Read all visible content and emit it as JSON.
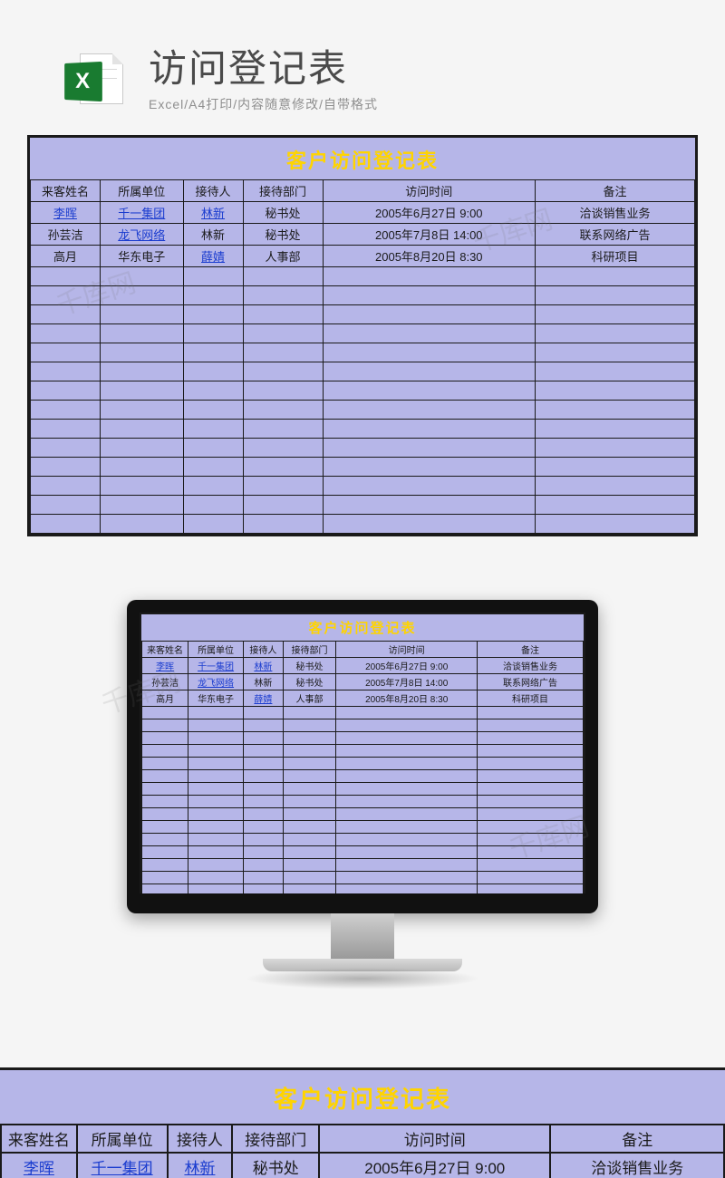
{
  "header": {
    "icon_letter": "X",
    "title": "访问登记表",
    "subtitle": "Excel/A4打印/内容随意修改/自带格式"
  },
  "sheet": {
    "title": "客户访问登记表",
    "columns": [
      "来客姓名",
      "所属单位",
      "接待人",
      "接待部门",
      "访问时间",
      "备注"
    ],
    "rows": [
      {
        "name": "李晖",
        "name_link": true,
        "org": "千一集团",
        "org_link": true,
        "recv": "林新",
        "recv_link": true,
        "dept": "秘书处",
        "time": "2005年6月27日  9:00",
        "note": "洽谈销售业务"
      },
      {
        "name": "孙芸洁",
        "name_link": false,
        "org": "龙飞网络",
        "org_link": true,
        "recv": "林新",
        "recv_link": false,
        "dept": "秘书处",
        "time": "2005年7月8日  14:00",
        "note": "联系网络广告"
      },
      {
        "name": "高月",
        "name_link": false,
        "org": "华东电子",
        "org_link": false,
        "recv": "薛婧",
        "recv_link": true,
        "dept": "人事部",
        "time": "2005年8月20日  8:30",
        "note": "科研项目"
      }
    ],
    "empty_rows_main": 14,
    "empty_rows_screen": 17
  },
  "watermark": "千库网"
}
